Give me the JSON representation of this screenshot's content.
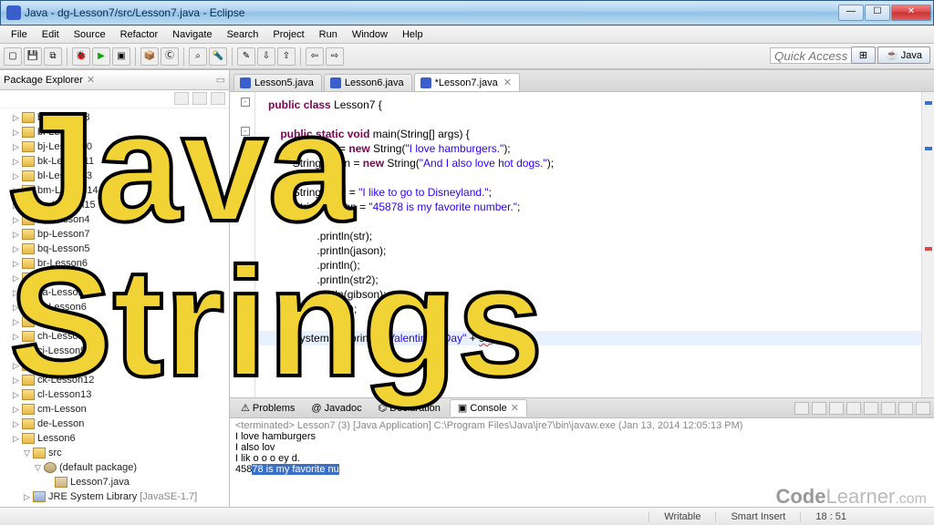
{
  "window": {
    "title": "Java - dg-Lesson7/src/Lesson7.java - Eclipse",
    "min": "—",
    "max": "☐",
    "close": "✕"
  },
  "menu": [
    "File",
    "Edit",
    "Source",
    "Refactor",
    "Navigate",
    "Search",
    "Project",
    "Run",
    "Window",
    "Help"
  ],
  "quick_access_placeholder": "Quick Access",
  "perspective": {
    "java": "Java"
  },
  "packageExplorer": {
    "title": "Package Explorer",
    "items": [
      {
        "label": "bh-Lesson8"
      },
      {
        "label": "bi-Lesson9"
      },
      {
        "label": "bj-Lesson10"
      },
      {
        "label": "bk-Lesson11"
      },
      {
        "label": "bl-Lesson13"
      },
      {
        "label": "bm-Lesson14"
      },
      {
        "label": "bn-Lesson15"
      },
      {
        "label": "bo-Lesson4"
      },
      {
        "label": "bp-Lesson7"
      },
      {
        "label": "bq-Lesson5"
      },
      {
        "label": "br-Lesson6"
      },
      {
        "label": "bs-Lesson7"
      },
      {
        "label": "ca-Lesson"
      },
      {
        "label": "cf-Lesson6"
      },
      {
        "label": "cg-Lesson7"
      },
      {
        "label": "ch-Lesson8"
      },
      {
        "label": "ci-Lesson9"
      },
      {
        "label": "cj-Lesson10"
      },
      {
        "label": "ck-Lesson12"
      },
      {
        "label": "cl-Lesson13"
      },
      {
        "label": "cm-Lesson"
      },
      {
        "label": "de-Lesson"
      },
      {
        "label": "Lesson6"
      }
    ],
    "open_project": {
      "src": "src",
      "pkg": "(default package)",
      "file": "Lesson7.java",
      "jre": "JRE System Library",
      "jre_suffix": "[JavaSE-1.7]"
    }
  },
  "tabs": [
    {
      "label": "Lesson5.java",
      "active": false
    },
    {
      "label": "Lesson6.java",
      "active": false
    },
    {
      "label": "*Lesson7.java",
      "active": true
    }
  ],
  "code": {
    "l1a": "public",
    "l1b": "class",
    "l1c": " Lesson7 {",
    "l3a": "public",
    "l3b": "static",
    "l3c": "void",
    "l3d": " main(String[] args) {",
    "l4a": "String str = ",
    "l4b": "new",
    "l4c": " String(",
    "l4d": "\"I love hamburgers.\"",
    "l4e": ");",
    "l5a": "String jason = ",
    "l5b": "new",
    "l5c": " String(",
    "l5d": "\"And I also love hot dogs.\"",
    "l5e": ");",
    "l7a": "String ",
    "l7b": "str2",
    "l7c": " = ",
    "l7d": "\"I like to go to Disneyland.\"",
    "l7e": ";",
    "l8a": "String gibson = ",
    "l8b": "\"45878 is my favorite number.\"",
    "l8c": ";",
    "p1": ".println(str);",
    "p2": ".println(jason);",
    "p3": ".println();",
    "p4": ".println(str2);",
    "p5": "rintln(gibson);",
    "p6": "rintln();",
    "caret_a": "System.",
    "caret_b": "out",
    "caret_c": ".println(",
    "caret_d": "\"Valentine's Day\"",
    "caret_e": " + ",
    "caret_f": "str",
    "caret_g": ");",
    "close_inner": "}",
    "close_outer": "}"
  },
  "bottomTabs": {
    "problems": "Problems",
    "javadoc": "Javadoc",
    "declaration": "Declaration",
    "console": "Console"
  },
  "console": {
    "term": "<terminated> Lesson7 (3) [Java Application] C:\\Program Files\\Java\\jre7\\bin\\javaw.exe (Jan 13, 2014 12:05:13 PM)",
    "l1": "I love hamburgers",
    "l2": "I also lov",
    "l3a": "I lik  o  o  o   ey  d.",
    "l3b": "458",
    "l3c": "78 is my favorite nu"
  },
  "status": {
    "writable": "Writable",
    "insert": "Smart Insert",
    "pos": "18 : 51"
  },
  "watermark_a": "Code",
  "watermark_b": "Learner",
  "watermark_c": ".com",
  "overlay": {
    "l1": "Java",
    "l2": "Strings"
  }
}
